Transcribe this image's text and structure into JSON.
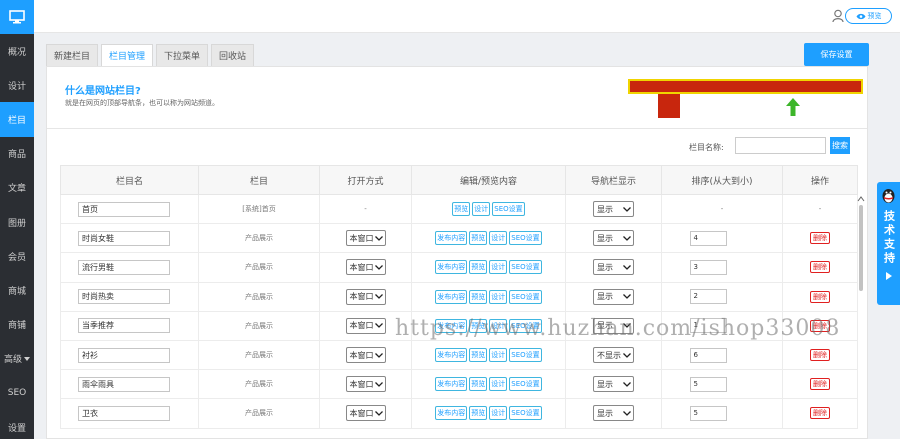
{
  "sidebar": {
    "items": [
      {
        "label": "概况"
      },
      {
        "label": "设计"
      },
      {
        "label": "栏目",
        "active": true
      },
      {
        "label": "商品"
      },
      {
        "label": "文章"
      },
      {
        "label": "图册"
      },
      {
        "label": "会员"
      },
      {
        "label": "商城"
      },
      {
        "label": "商铺"
      },
      {
        "label": "高级"
      },
      {
        "label": "SEO"
      },
      {
        "label": "设置"
      }
    ]
  },
  "topbar": {
    "preview_label": "预览"
  },
  "tabs": [
    {
      "label": "新建栏目"
    },
    {
      "label": "栏目管理",
      "active": true
    },
    {
      "label": "下拉菜单"
    },
    {
      "label": "回收站"
    }
  ],
  "save_label": "保存设置",
  "info": {
    "title": "什么是网站栏目?",
    "desc": "就是在网页的顶部导航条，也可以称为网站频道。"
  },
  "search": {
    "label": "栏目名称:",
    "button": "搜索"
  },
  "table": {
    "headers": [
      "栏目名",
      "栏目",
      "打开方式",
      "编辑/预览内容",
      "导航栏显示",
      "排序(从大到小)",
      "操作"
    ],
    "rows": [
      {
        "name": "首页",
        "type": "[系统]首页",
        "open": "-",
        "actions": [
          "预览",
          "设计",
          "SEO设置"
        ],
        "nav": "显示",
        "order": "-",
        "op": "-"
      },
      {
        "name": "时尚女鞋",
        "type": "产品展示",
        "open": "本窗口",
        "actions": [
          "发布内容",
          "预览",
          "设计",
          "SEO设置"
        ],
        "nav": "显示",
        "order": "4",
        "op": "删除"
      },
      {
        "name": "流行男鞋",
        "type": "产品展示",
        "open": "本窗口",
        "actions": [
          "发布内容",
          "预览",
          "设计",
          "SEO设置"
        ],
        "nav": "显示",
        "order": "3",
        "op": "删除"
      },
      {
        "name": "时尚热卖",
        "type": "产品展示",
        "open": "本窗口",
        "actions": [
          "发布内容",
          "预览",
          "设计",
          "SEO设置"
        ],
        "nav": "显示",
        "order": "2",
        "op": "删除"
      },
      {
        "name": "当季推荐",
        "type": "产品展示",
        "open": "本窗口",
        "actions": [
          "发布内容",
          "预览",
          "设计",
          "SEO设置"
        ],
        "nav": "显示",
        "order": "1",
        "op": "删除"
      },
      {
        "name": "衬衫",
        "type": "产品展示",
        "open": "本窗口",
        "actions": [
          "发布内容",
          "预览",
          "设计",
          "SEO设置"
        ],
        "nav": "不显示",
        "order": "6",
        "op": "删除"
      },
      {
        "name": "雨伞雨具",
        "type": "产品展示",
        "open": "本窗口",
        "actions": [
          "发布内容",
          "预览",
          "设计",
          "SEO设置"
        ],
        "nav": "显示",
        "order": "5",
        "op": "删除"
      },
      {
        "name": "卫衣",
        "type": "产品展示",
        "open": "本窗口",
        "actions": [
          "发布内容",
          "预览",
          "设计",
          "SEO设置"
        ],
        "nav": "显示",
        "order": "5",
        "op": "删除"
      }
    ]
  },
  "support_label": "技术支持",
  "watermark": "https://www.huzhan.com/ishop33008",
  "colors": {
    "accent": "#1e9fff",
    "sidebar": "#2b2e33",
    "danger": "#e02020",
    "demo_bar": "#c8260d",
    "arrow": "#3cb52a"
  }
}
